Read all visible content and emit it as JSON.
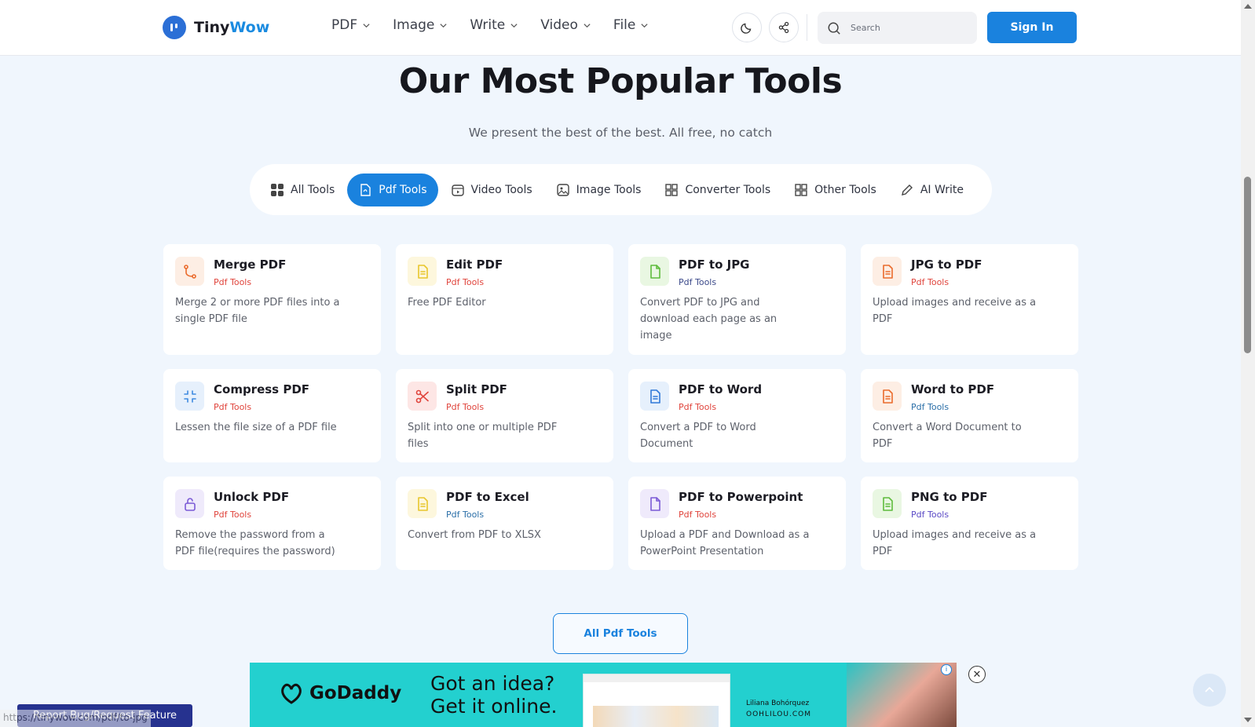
{
  "header": {
    "logo_part1": "Tiny",
    "logo_part2": "Wow",
    "nav": [
      "PDF",
      "Image",
      "Write",
      "Video",
      "File"
    ],
    "search_placeholder": "Search",
    "sign_in": "Sign In"
  },
  "hero": {
    "title": "Our Most Popular Tools",
    "subtitle": "We present the best of the best. All free, no catch"
  },
  "tabs": [
    "All Tools",
    "Pdf Tools",
    "Video Tools",
    "Image Tools",
    "Converter Tools",
    "Other Tools",
    "AI Write"
  ],
  "active_tab": "Pdf Tools",
  "tools": [
    {
      "name": "Merge PDF",
      "category": "Pdf Tools",
      "description": "Merge 2 or more PDF files into a single PDF file",
      "icon": "merge-icon",
      "icon_color": "#ea6b2c",
      "icon_bg": "#fdeee4",
      "cat_color": "#e0443c"
    },
    {
      "name": "Edit PDF",
      "category": "Pdf Tools",
      "description": "Free PDF Editor",
      "icon": "document-icon",
      "icon_color": "#e8c62c",
      "icon_bg": "#fdf7dd",
      "cat_color": "#e0443c"
    },
    {
      "name": "PDF to JPG",
      "category": "Pdf Tools",
      "description": "Convert PDF to JPG and download each page as an image",
      "icon": "file-icon",
      "icon_color": "#5ebc3c",
      "icon_bg": "#e9f7e2",
      "cat_color": "#3c4a8a"
    },
    {
      "name": "JPG to PDF",
      "category": "Pdf Tools",
      "description": "Upload images and receive as a PDF",
      "icon": "document-icon",
      "icon_color": "#ea6b2c",
      "icon_bg": "#fdeee4",
      "cat_color": "#e0443c"
    },
    {
      "name": "Compress PDF",
      "category": "Pdf Tools",
      "description": "Lessen the file size of a PDF file",
      "icon": "compress-icon",
      "icon_color": "#3f8ae0",
      "icon_bg": "#e6f0fc",
      "cat_color": "#e0443c"
    },
    {
      "name": "Split PDF",
      "category": "Pdf Tools",
      "description": "Split into one or multiple PDF files",
      "icon": "scissors-icon",
      "icon_color": "#e0443c",
      "icon_bg": "#fde6e5",
      "cat_color": "#e0443c"
    },
    {
      "name": "PDF to Word",
      "category": "Pdf Tools",
      "description": "Convert a PDF to Word Document",
      "icon": "document-icon",
      "icon_color": "#2f78d8",
      "icon_bg": "#e6f0fc",
      "cat_color": "#e0443c"
    },
    {
      "name": "Word to PDF",
      "category": "Pdf Tools",
      "description": "Convert a Word Document to PDF",
      "icon": "document-icon",
      "icon_color": "#ea6b2c",
      "icon_bg": "#fdeee4",
      "cat_color": "#2b6fa8"
    },
    {
      "name": "Unlock PDF",
      "category": "Pdf Tools",
      "description": "Remove the password from a PDF file(requires the password)",
      "icon": "unlock-icon",
      "icon_color": "#7b5ad6",
      "icon_bg": "#efeafb",
      "cat_color": "#e0443c"
    },
    {
      "name": "PDF to Excel",
      "category": "Pdf Tools",
      "description": "Convert from PDF to XLSX",
      "icon": "document-icon",
      "icon_color": "#e8c62c",
      "icon_bg": "#fdf7dd",
      "cat_color": "#2b6fa8"
    },
    {
      "name": "PDF to Powerpoint",
      "category": "Pdf Tools",
      "description": "Upload a PDF and Download as a PowerPoint Presentation",
      "icon": "file-icon",
      "icon_color": "#7b5ad6",
      "icon_bg": "#efeafb",
      "cat_color": "#e0443c"
    },
    {
      "name": "PNG to PDF",
      "category": "Pdf Tools",
      "description": "Upload images and receive as a PDF",
      "icon": "document-icon",
      "icon_color": "#5ebc3c",
      "icon_bg": "#e9f7e2",
      "cat_color": "#5b4ac6"
    }
  ],
  "all_button": "All Pdf Tools",
  "ad": {
    "brand": "GoDaddy",
    "headline_line1": "Got an idea?",
    "headline_line2": "Get it online.",
    "person_name": "Liliana Bohórquez",
    "person_site": "OOHLILOU.COM"
  },
  "report_button": "Report Bug/Request Feature",
  "status_url": "https://tinywow.com/pdf/to-jpg",
  "colors": {
    "accent": "#1a82de",
    "background": "#f0f6fd"
  }
}
